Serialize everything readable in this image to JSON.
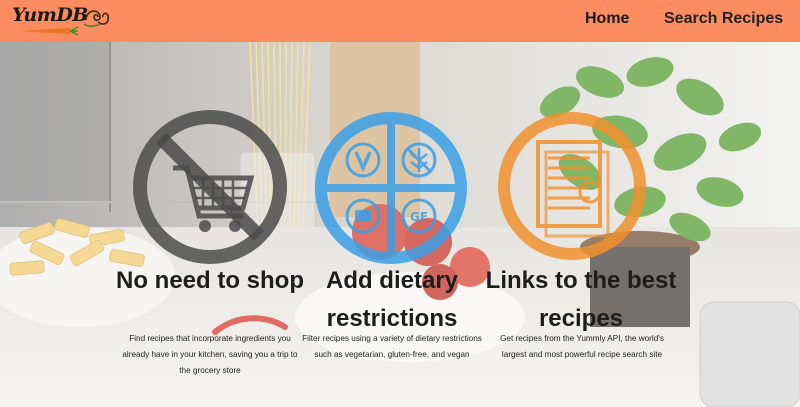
{
  "brand": {
    "name": "YumDB"
  },
  "nav": {
    "home": "Home",
    "search": "Search Recipes"
  },
  "colors": {
    "navbar": "#fb8c5f",
    "icon_gray": "#555555",
    "icon_blue": "#3aa0e6",
    "icon_orange": "#f0912e"
  },
  "features": [
    {
      "icon": "no-shopping-cart-icon",
      "title": "No need to shop",
      "description": "Find recipes that incorporate ingredients you already have in your kitchen, saving you a trip to the grocery store"
    },
    {
      "icon": "dietary-restrictions-icon",
      "title": "Add dietary restrictions",
      "description": "Filter recipes using a variety of dietary restrictions such as vegetarian, gluten-free, and vegan"
    },
    {
      "icon": "recipe-document-icon",
      "title": "Links to the best recipes",
      "description": "Get recipes from the Yummly API, the world's largest and most powerful recipe search site"
    }
  ]
}
